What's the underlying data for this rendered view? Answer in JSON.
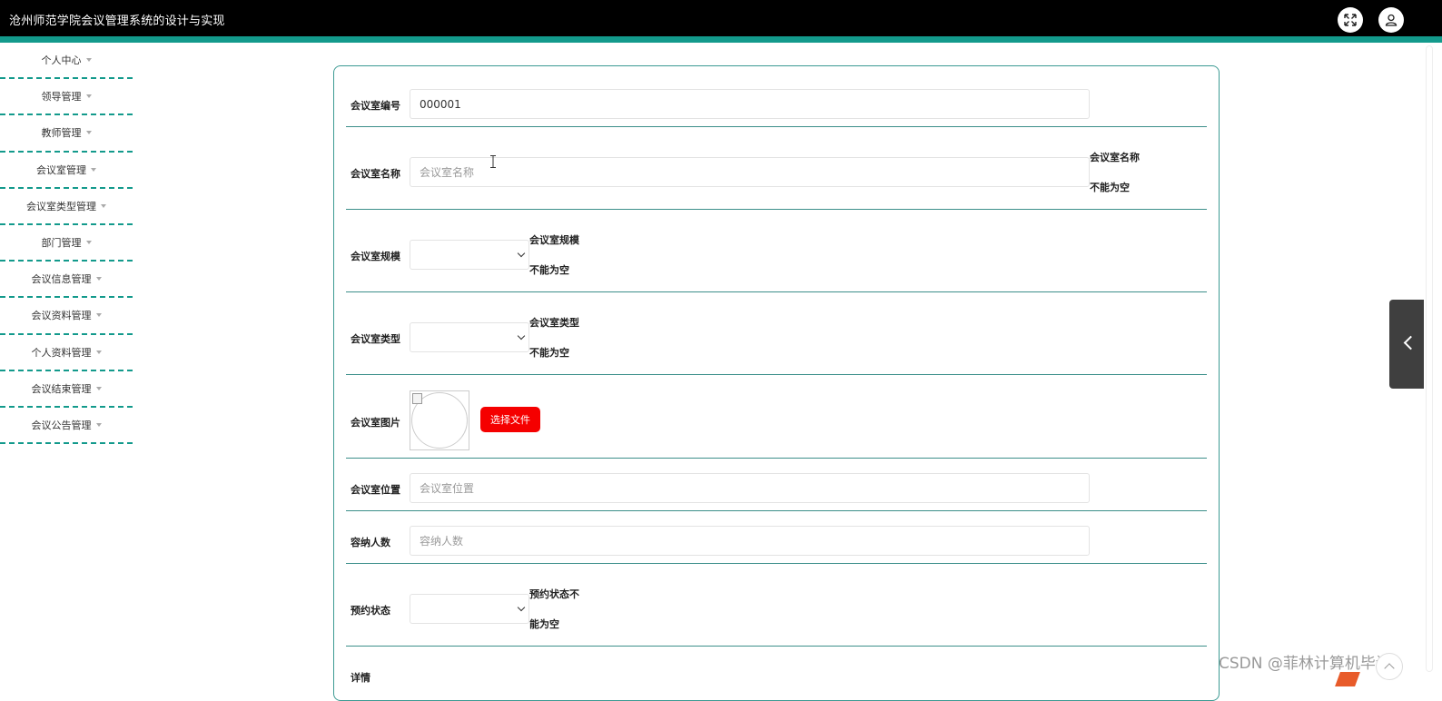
{
  "header": {
    "title": "沧州师范学院会议管理系统的设计与实现",
    "accent_color": "#139a8c",
    "fullscreen_icon": "expand-arrows-icon",
    "user_icon": "user-icon"
  },
  "sidebar": {
    "items": [
      {
        "label": "个人中心"
      },
      {
        "label": "领导管理"
      },
      {
        "label": "教师管理"
      },
      {
        "label": "会议室管理"
      },
      {
        "label": "会议室类型管理"
      },
      {
        "label": "部门管理"
      },
      {
        "label": "会议信息管理"
      },
      {
        "label": "会议资料管理"
      },
      {
        "label": "个人资料管理"
      },
      {
        "label": "会议结束管理"
      },
      {
        "label": "会议公告管理"
      }
    ]
  },
  "form": {
    "room_no": {
      "label": "会议室编号",
      "value": "000001"
    },
    "room_name": {
      "label": "会议室名称",
      "placeholder": "会议室名称",
      "error_line1": "会议室名称",
      "error_line2": "不能为空"
    },
    "room_scale": {
      "label": "会议室规模",
      "error_line1": "会议室规模",
      "error_line2": "不能为空"
    },
    "room_type": {
      "label": "会议室类型",
      "error_line1": "会议室类型",
      "error_line2": "不能为空"
    },
    "room_image": {
      "label": "会议室图片",
      "button": "选择文件"
    },
    "room_location": {
      "label": "会议室位置",
      "placeholder": "会议室位置"
    },
    "capacity": {
      "label": "容纳人数",
      "placeholder": "容纳人数"
    },
    "booking_status": {
      "label": "预约状态",
      "error_line1": "预约状态不",
      "error_line2": "能为空"
    },
    "details": {
      "label": "详情"
    }
  },
  "watermark": "CSDN @菲林计算机毕设"
}
